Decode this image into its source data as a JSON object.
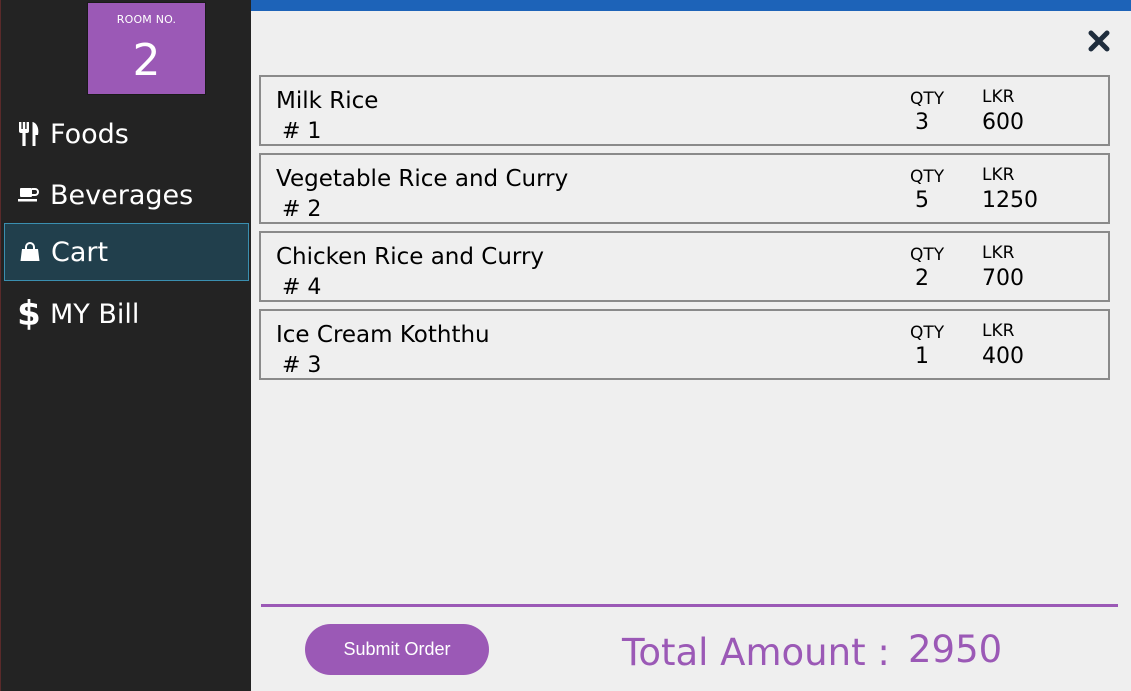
{
  "room": {
    "label": "ROOM NO.",
    "number": "2"
  },
  "sidebar": {
    "items": [
      {
        "label": "Foods",
        "icon": "cutlery-icon"
      },
      {
        "label": "Beverages",
        "icon": "coffee-icon"
      },
      {
        "label": "Cart",
        "icon": "shopping-bag-icon",
        "active": true
      },
      {
        "label": "MY Bill",
        "icon": "dollar-icon"
      }
    ]
  },
  "cart": {
    "qty_label": "QTY",
    "currency_label": "LKR",
    "items": [
      {
        "name": "Milk Rice",
        "id": "# 1",
        "qty": "3",
        "price": "600"
      },
      {
        "name": "Vegetable Rice and Curry",
        "id": "# 2",
        "qty": "5",
        "price": "1250"
      },
      {
        "name": "Chicken Rice and Curry",
        "id": "# 4",
        "qty": "2",
        "price": "700"
      },
      {
        "name": "Ice Cream Koththu",
        "id": "# 3",
        "qty": "1",
        "price": "400"
      }
    ]
  },
  "footer": {
    "submit_label": "Submit Order",
    "total_label": "Total Amount :",
    "total_value": "2950"
  },
  "colors": {
    "accent": "#9b59b6",
    "sidebar_bg": "#232323",
    "active_bg": "#213f4c",
    "panel_bg": "#efefef"
  }
}
